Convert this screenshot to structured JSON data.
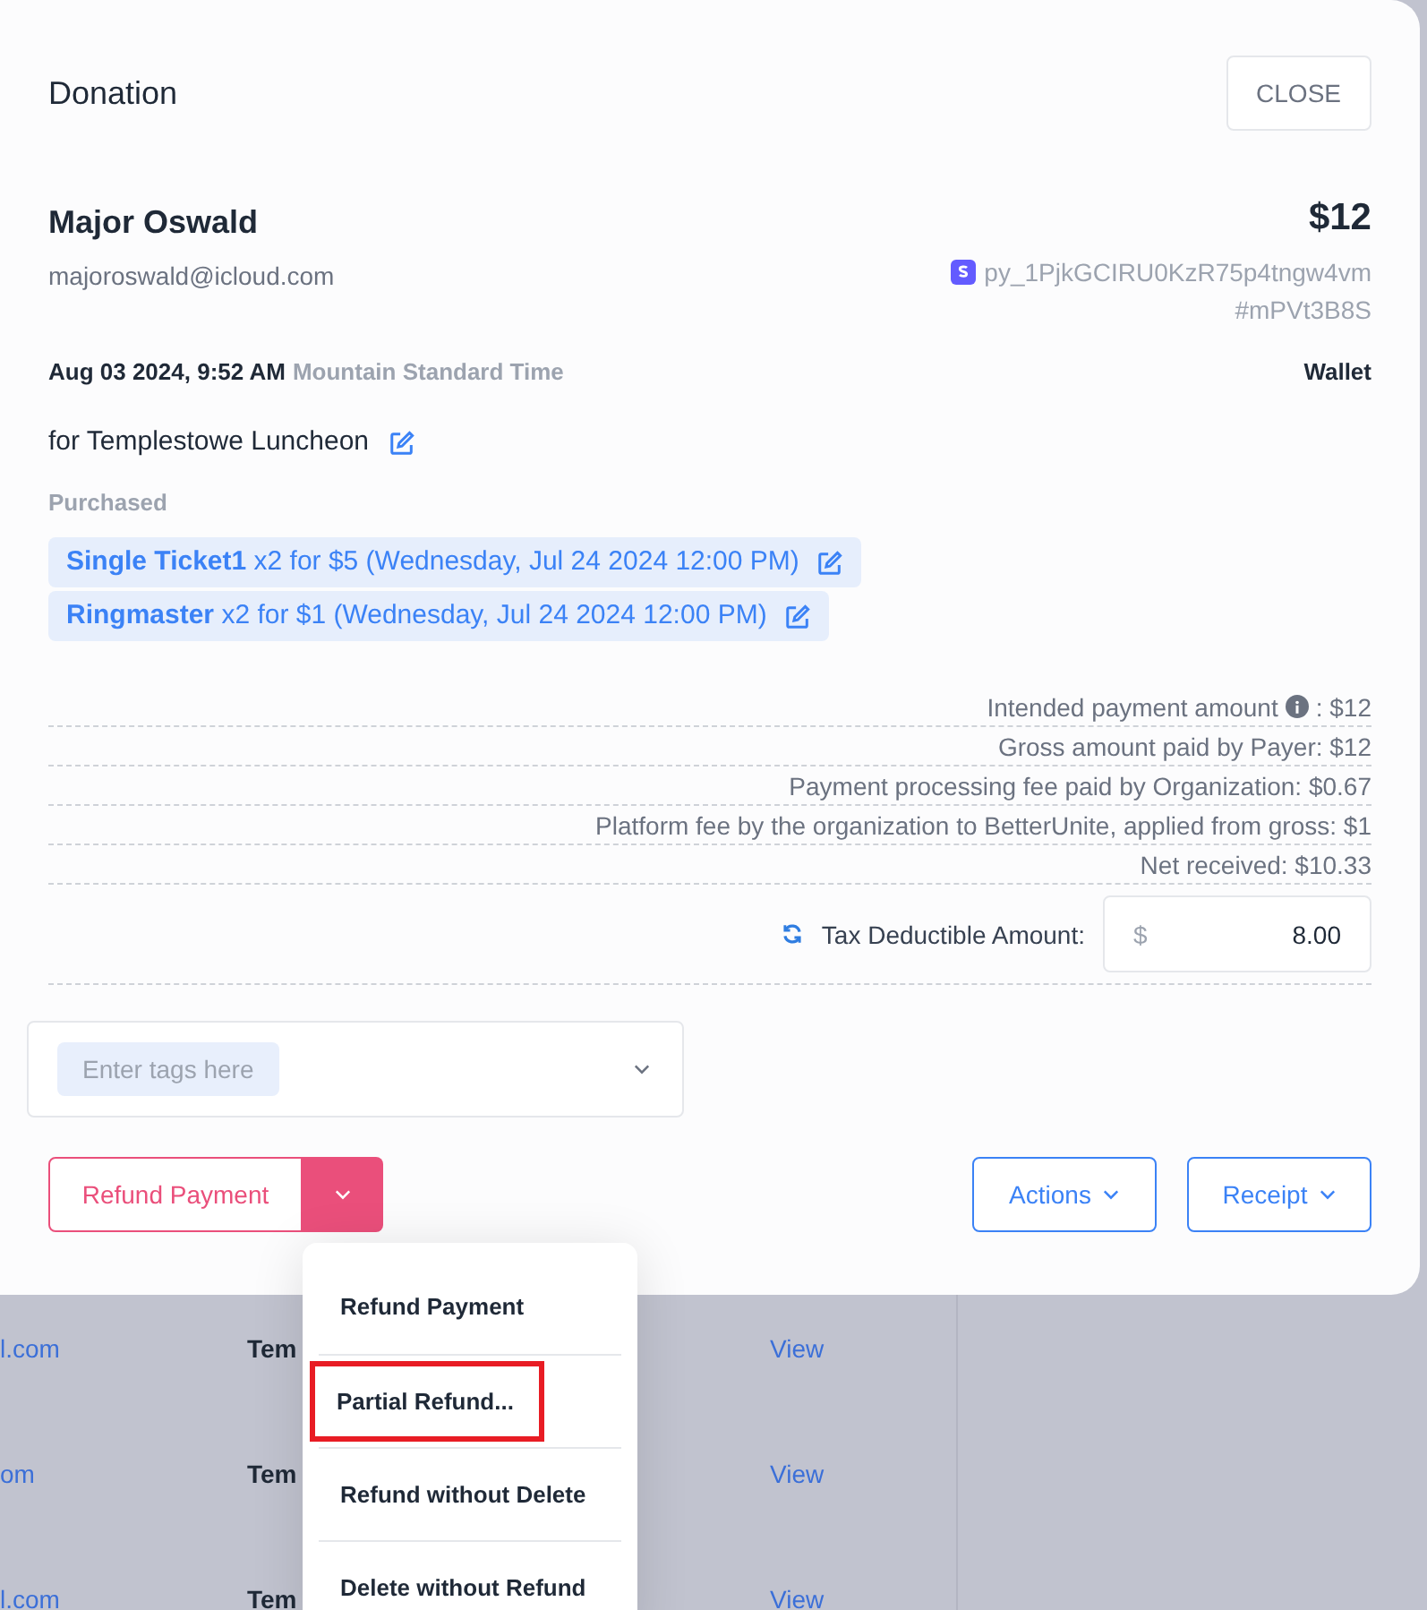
{
  "background_table": {
    "rows": [
      {
        "column_1": "l.com",
        "column_2": "Tem",
        "column_3": "View"
      },
      {
        "column_1": "om",
        "column_2": "Tem",
        "column_3": "View"
      },
      {
        "column_1": "l.com",
        "column_2": "Tem",
        "column_3": "View"
      }
    ]
  },
  "dialog": {
    "title": "Donation",
    "close_button": "CLOSE",
    "donor": {
      "name": "Major Oswald",
      "email": "majoroswald@icloud.com"
    },
    "amount": "$12",
    "payment_id": "py_1PjkGCIRU0KzR75p4tngw4vm",
    "reference": "#mPVt3B8S",
    "date": "Aug 03 2024, 9:52 AM",
    "timezone": "Mountain Standard Time",
    "method": "Wallet",
    "campaign": "for Templestowe Luncheon",
    "purchased_label": "Purchased",
    "purchases": [
      {
        "name": "Single Ticket1",
        "detail": "x2 for $5 (Wednesday, Jul 24 2024 12:00 PM)"
      },
      {
        "name": "Ringmaster",
        "detail": "x2 for $1 (Wednesday, Jul 24 2024 12:00 PM)"
      }
    ],
    "summary": [
      {
        "kind": "info",
        "label": "Intended payment amount",
        "value": ": $12"
      },
      {
        "kind": "plain",
        "label": "Gross amount paid by Payer:",
        "value": " $12"
      },
      {
        "kind": "plain",
        "label": "Payment processing fee paid by Organization:",
        "value": " $0.67"
      },
      {
        "kind": "plain",
        "label": "Platform fee by the organization to BetterUnite, applied from gross:",
        "value": " $1"
      },
      {
        "kind": "plain",
        "label": "Net received:",
        "value": " $10.33"
      }
    ],
    "tax_deductible": {
      "label": "Tax Deductible Amount:",
      "currency": "$",
      "value": "8.00"
    },
    "tags": {
      "placeholder": "Enter tags here"
    },
    "buttons": {
      "refund": "Refund Payment",
      "actions": "Actions",
      "receipt": "Receipt"
    }
  },
  "refund_menu": {
    "items": [
      {
        "label": "Refund Payment",
        "highlighted": false
      },
      {
        "label": "Partial Refund...",
        "highlighted": true
      },
      {
        "label": "Refund without Delete",
        "highlighted": false
      },
      {
        "label": "Delete without Refund",
        "highlighted": false
      }
    ]
  }
}
